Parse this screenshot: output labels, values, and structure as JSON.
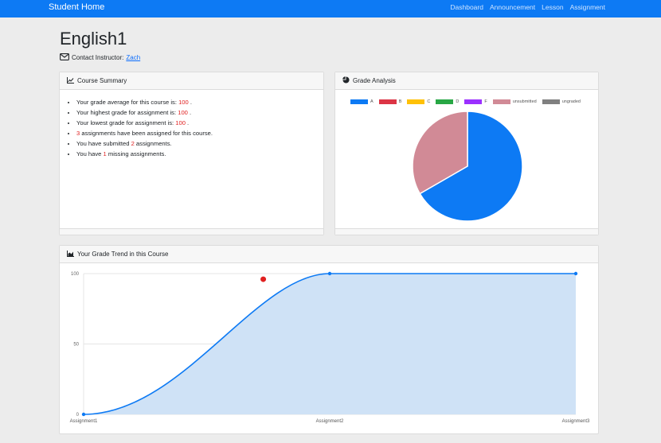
{
  "nav": {
    "brand": "Student Home",
    "links": [
      "Dashboard",
      "Announcement",
      "Lesson",
      "Assignment"
    ]
  },
  "page": {
    "title": "English1",
    "contact_label": "Contact Instructor:",
    "contact_name": "Zach"
  },
  "summary": {
    "title": "Course Summary",
    "average_prefix": "Your grade average for this course is:",
    "average_value": "100",
    "highest_prefix": "Your highest grade for assignment is:",
    "highest_value": "100",
    "lowest_prefix": "Your lowest grade for assignment is:",
    "lowest_value": "100",
    "assigned_count": "3",
    "assigned_suffix": "assignments have been assigned for this course.",
    "submitted_prefix": "You have submitted",
    "submitted_count": "2",
    "submitted_suffix": "assignments.",
    "missing_prefix": "You have",
    "missing_count": "1",
    "missing_suffix": "missing assignments."
  },
  "analysis": {
    "title": "Grade Analysis"
  },
  "trend": {
    "title": "Your Grade Trend in this Course"
  },
  "colors": {
    "navbar": "#0d7af4",
    "accent_red": "#e02020"
  },
  "chart_data": [
    {
      "type": "pie",
      "title": "Grade Analysis",
      "legend_position": "top",
      "categories": [
        "A",
        "B",
        "C",
        "D",
        "F",
        "unsubmitted",
        "ungraded"
      ],
      "values": [
        2,
        0,
        0,
        0,
        0,
        1,
        0
      ],
      "colors": [
        "#0d7af4",
        "#dc3545",
        "#ffc107",
        "#28a745",
        "#9b30ff",
        "#d18a96",
        "#808080"
      ]
    },
    {
      "type": "area",
      "title": "Your Grade Trend in this Course",
      "categories": [
        "Assignment1",
        "Assignment2",
        "Assignment3"
      ],
      "series": [
        {
          "values": [
            0,
            100,
            100
          ]
        }
      ],
      "ylim": [
        0,
        100
      ],
      "yticks": [
        0,
        50,
        100
      ],
      "grid": true,
      "line_color": "#0d7af4",
      "fill_color": "#cfe2f6",
      "marker": {
        "x_position": 0.365,
        "y": 96,
        "color": "#e02020"
      }
    }
  ]
}
